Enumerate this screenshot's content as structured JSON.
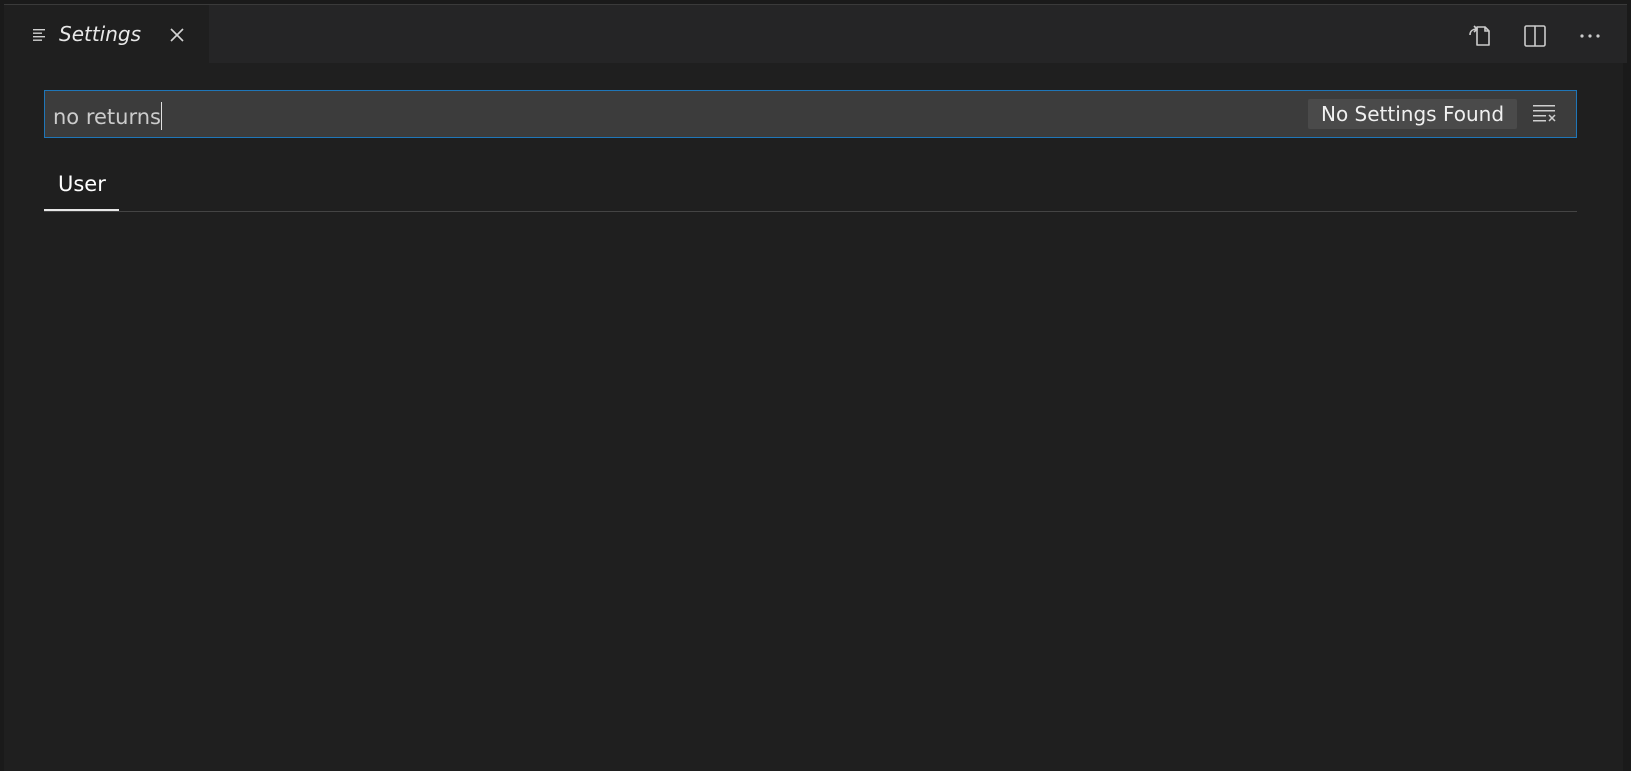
{
  "tab": {
    "title": "Settings",
    "icon": "settings-list-icon",
    "close_icon": "close-icon"
  },
  "editor_actions": [
    {
      "icon": "open-settings-json-icon"
    },
    {
      "icon": "split-editor-icon"
    },
    {
      "icon": "more-actions-icon"
    }
  ],
  "search": {
    "value": "no returns",
    "results": "No Settings Found",
    "clear_icon": "clear-filter-icon"
  },
  "scopes": [
    {
      "label": "User",
      "active": true
    }
  ],
  "colors": {
    "focus_border": "#1f76b8",
    "editor_bg": "#1f1f1f",
    "tabbar_bg": "#252526"
  }
}
